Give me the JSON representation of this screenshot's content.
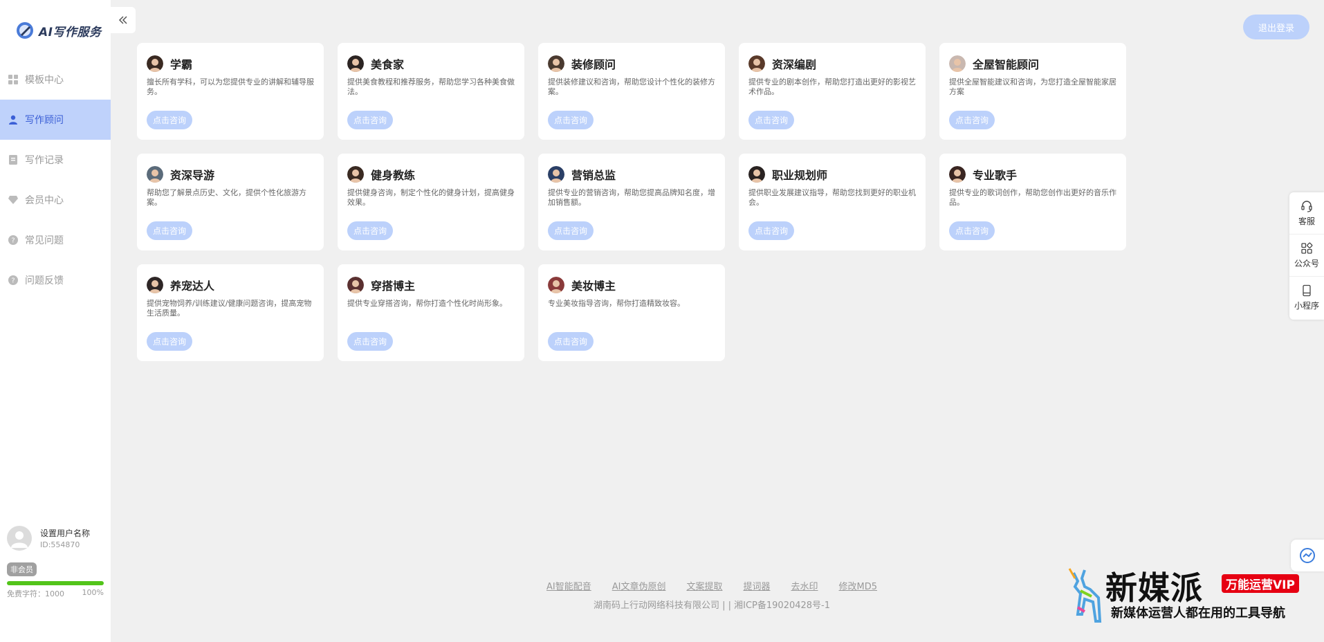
{
  "app": {
    "logo_text": "AI写作服务"
  },
  "sidebar": {
    "items": [
      {
        "label": "模板中心",
        "icon": "grid-icon",
        "active": false
      },
      {
        "label": "写作顾问",
        "icon": "user-icon",
        "active": true
      },
      {
        "label": "写作记录",
        "icon": "document-icon",
        "active": false
      },
      {
        "label": "会员中心",
        "icon": "diamond-icon",
        "active": false
      },
      {
        "label": "常见问题",
        "icon": "question-icon",
        "active": false
      },
      {
        "label": "问题反馈",
        "icon": "question-icon",
        "active": false
      }
    ],
    "user": {
      "name": "设置用户名称",
      "id": "ID:554870",
      "member_badge": "非会员",
      "quota_label": "免费字符：1000",
      "quota_percent_label": "100%",
      "quota_fraction": 1.0
    }
  },
  "header": {
    "logout_label": "退出登录"
  },
  "cards": [
    {
      "title": "学霸",
      "desc": "擅长所有学科，可以为您提供专业的讲解和辅导服务。",
      "button": "点击咨询"
    },
    {
      "title": "美食家",
      "desc": "提供美食教程和推荐服务，帮助您学习各种美食做法。",
      "button": "点击咨询"
    },
    {
      "title": "装修顾问",
      "desc": "提供装修建议和咨询，帮助您设计个性化的装修方案。",
      "button": "点击咨询"
    },
    {
      "title": "资深编剧",
      "desc": "提供专业的剧本创作，帮助您打造出更好的影视艺术作品。",
      "button": "点击咨询"
    },
    {
      "title": "全屋智能顾问",
      "desc": "提供全屋智能建议和咨询，为您打造全屋智能家居方案",
      "button": "点击咨询"
    },
    {
      "title": "资深导游",
      "desc": "帮助您了解景点历史、文化，提供个性化旅游方案。",
      "button": "点击咨询"
    },
    {
      "title": "健身教练",
      "desc": "提供健身咨询，制定个性化的健身计划，提高健身效果。",
      "button": "点击咨询"
    },
    {
      "title": "营销总监",
      "desc": "提供专业的营销咨询，帮助您提高品牌知名度，增加销售额。",
      "button": "点击咨询"
    },
    {
      "title": "职业规划师",
      "desc": "提供职业发展建议指导，帮助您找到更好的职业机会。",
      "button": "点击咨询"
    },
    {
      "title": "专业歌手",
      "desc": "提供专业的歌词创作，帮助您创作出更好的音乐作品。",
      "button": "点击咨询"
    },
    {
      "title": "养宠达人",
      "desc": "提供宠物饲养/训练建议/健康问题咨询，提高宠物生活质量。",
      "button": "点击咨询"
    },
    {
      "title": "穿搭博主",
      "desc": "提供专业穿搭咨询，帮你打造个性化时尚形象。",
      "button": "点击咨询"
    },
    {
      "title": "美妆博主",
      "desc": "专业美妆指导咨询，帮你打造精致妆容。",
      "button": "点击咨询"
    }
  ],
  "float_bar": [
    {
      "label": "客服",
      "icon": "headset-icon"
    },
    {
      "label": "公众号",
      "icon": "apps-icon"
    },
    {
      "label": "小程序",
      "icon": "tablet-icon"
    }
  ],
  "footer": {
    "links": [
      "AI智能配音",
      "AI文章伪原创",
      "文案提取",
      "提词器",
      "去水印",
      "修改MD5"
    ],
    "copyright": "湖南码上行动网络科技有限公司 | | 湘ICP备19020428号-1"
  },
  "ad": {
    "title": "新媒派",
    "badge": "万能运营VIP",
    "subtitle": "新媒体运营人都在用的工具导航"
  },
  "colors": {
    "accent": "#3b5fd6",
    "active_bg": "#bfd2fb",
    "button_bg": "#bcd1fb",
    "progress": "#52c41a",
    "ad_badge": "#e60012"
  }
}
